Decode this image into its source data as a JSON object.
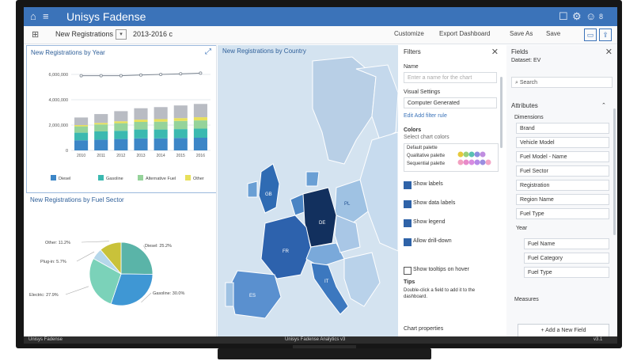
{
  "app": {
    "title": "Unisys Fadense",
    "user_initial": "8"
  },
  "toolbar": {
    "view_label": "New Registrations",
    "year_range": "2013-2016 c",
    "buttons": [
      "Customize",
      "Export Dashboard",
      "Save As",
      "Save"
    ]
  },
  "bar_panel": {
    "title": "New Registrations by Year"
  },
  "pie_panel": {
    "title": "New Registrations by Fuel Sector"
  },
  "map_panel": {
    "title": "New Registrations by Country"
  },
  "filters": {
    "title": "Filters",
    "name_label": "Name",
    "name_placeholder": "Enter a name for the chart",
    "visual_label": "Visual Settings",
    "visual_value": "Computer Generated",
    "links": "Edit  Add filter rule",
    "colors_label": "Colors",
    "colors_sub": "Select chart colors",
    "palette_1": "Default palette",
    "palette_2": "Qualitative palette",
    "palette_3": "Sequential palette",
    "option_1": "Show labels",
    "option_2": "Show data labels",
    "option_3": "Show legend",
    "option_4": "Allow drill-down",
    "option_5": "Show tooltips on hover",
    "note_title": "Tips",
    "note_text": "Double-click a field to add it to the dashboard.",
    "bottom_label": "Chart properties"
  },
  "fields": {
    "title": "Fields",
    "subtitle": "Dataset: EV",
    "search_placeholder": "Search",
    "section": "Attributes",
    "group_label": "Dimensions",
    "items": [
      "Brand",
      "Vehicle Model",
      "Fuel Model - Name",
      "Fuel Sector",
      "Registration",
      "Region Name",
      "Fuel Type"
    ],
    "group2": "Year",
    "sub_items": [
      "Fuel Name",
      "Fuel Category",
      "Fuel Type"
    ],
    "measures_label": "Measures",
    "add_button": "Add a New Field"
  },
  "status": {
    "left": "Unisys Fadense",
    "center": "Unisys Fadense Analytics v3",
    "right": "v3.1"
  },
  "chart_data": [
    {
      "type": "bar",
      "title": "New Registrations by Year",
      "categories": [
        "2010",
        "2011",
        "2012",
        "2013",
        "2014",
        "2015",
        "2016"
      ],
      "ytick_labels": [
        "0",
        "2,000,000",
        "4,000,000",
        "6,000,000"
      ],
      "series": [
        {
          "color": "#3c86c7",
          "values": [
            800000,
            850000,
            900000,
            950000,
            950000,
            980000,
            1000000
          ]
        },
        {
          "color": "#3bb9b0",
          "values": [
            600000,
            650000,
            650000,
            700000,
            700000,
            700000,
            720000
          ]
        },
        {
          "color": "#95d39a",
          "values": [
            500000,
            550000,
            600000,
            600000,
            620000,
            650000,
            650000
          ]
        },
        {
          "color": "#e8e05a",
          "values": [
            100000,
            120000,
            150000,
            180000,
            200000,
            220000,
            250000
          ]
        },
        {
          "color": "#b9bcc3",
          "values": [
            600000,
            700000,
            800000,
            900000,
            950000,
            1000000,
            1050000
          ]
        }
      ],
      "line_values": [
        5900000,
        5900000,
        5900000,
        5950000,
        6000000,
        6050000,
        6100000
      ],
      "legend": [
        "Diesel",
        "Gasoline",
        "Alternative Fuel",
        "Other"
      ],
      "ylim": [
        0,
        6500000
      ]
    },
    {
      "type": "pie",
      "title": "New Registrations by Fuel Sector",
      "labels": [
        "Diesel: 25.2%",
        "Gasoline: 30.0%",
        "Electric: 27.9%",
        "Plug-in: 5.7%",
        "Other: 11.2%"
      ],
      "values": [
        25.2,
        30.0,
        27.9,
        5.7,
        11.2
      ],
      "colors": [
        "#5ab4a8",
        "#3f97d4",
        "#7bd2b9",
        "#b5d7ea",
        "#c9c23a"
      ]
    }
  ],
  "map_labels": [
    {
      "name": "DE",
      "value": "DE"
    },
    {
      "name": "FR",
      "value": "FR"
    },
    {
      "name": "GB",
      "value": "GB"
    },
    {
      "name": "IT",
      "value": "IT"
    },
    {
      "name": "ES",
      "value": "ES"
    },
    {
      "name": "PL",
      "value": "PL"
    }
  ],
  "colors": {
    "accent": "#3b73b9",
    "dark_blue": "#1e4d8f"
  }
}
